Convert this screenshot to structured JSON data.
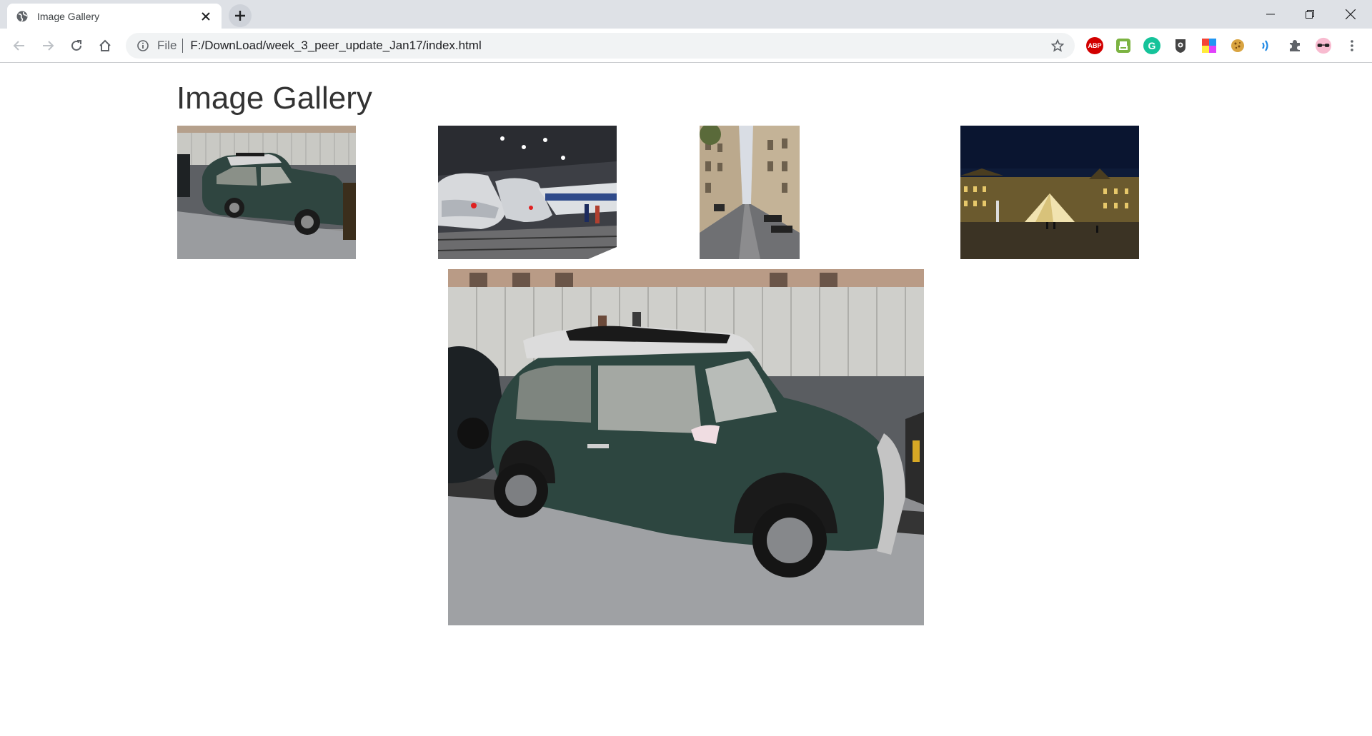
{
  "browser": {
    "tab_title": "Image Gallery",
    "address_scheme": "File",
    "address_url": "F:/DownLoad/week_3_peer_update_Jan17/index.html",
    "extensions": [
      {
        "name": "adblock-plus-icon",
        "label": "ABP",
        "color": "#d20000"
      },
      {
        "name": "print-friendly-icon",
        "label": "",
        "color": "#7cb342"
      },
      {
        "name": "grammarly-icon",
        "label": "G",
        "color": "#15c39a"
      },
      {
        "name": "privacy-shield-icon",
        "label": "",
        "color": "#444444"
      },
      {
        "name": "color-grid-icon",
        "label": "",
        "color": "#ff4081"
      },
      {
        "name": "cookie-icon",
        "label": "",
        "color": "#d9a441"
      },
      {
        "name": "read-aloud-icon",
        "label": "",
        "color": "#1e88e5"
      },
      {
        "name": "extensions-puzzle-icon",
        "label": "",
        "color": "#5f6368"
      }
    ]
  },
  "page": {
    "heading": "Image Gallery",
    "thumbnails": [
      {
        "name": "thumbnail-mini-car",
        "subject": "green Mini Cooper parked on street"
      },
      {
        "name": "thumbnail-train-station",
        "subject": "high-speed trains at station platform"
      },
      {
        "name": "thumbnail-paris-street",
        "subject": "narrow Paris street between buildings"
      },
      {
        "name": "thumbnail-louvre-night",
        "subject": "Louvre pyramid at night"
      }
    ],
    "main_image": {
      "subject": "green Mini Cooper parked on street"
    }
  }
}
